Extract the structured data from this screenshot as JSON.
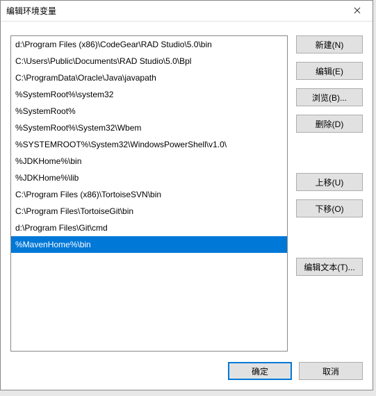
{
  "dialog": {
    "title": "编辑环境变量"
  },
  "list": {
    "items": [
      "d:\\Program Files (x86)\\CodeGear\\RAD Studio\\5.0\\bin",
      "C:\\Users\\Public\\Documents\\RAD Studio\\5.0\\Bpl",
      "C:\\ProgramData\\Oracle\\Java\\javapath",
      "%SystemRoot%\\system32",
      "%SystemRoot%",
      "%SystemRoot%\\System32\\Wbem",
      "%SYSTEMROOT%\\System32\\WindowsPowerShell\\v1.0\\",
      "%JDKHome%\\bin",
      "%JDKHome%\\lib",
      "C:\\Program Files (x86)\\TortoiseSVN\\bin",
      "C:\\Program Files\\TortoiseGit\\bin",
      "d:\\Program Files\\Git\\cmd",
      "%MavenHome%\\bin"
    ],
    "selected_index": 12
  },
  "buttons": {
    "new": "新建(N)",
    "edit": "编辑(E)",
    "browse": "浏览(B)...",
    "delete": "删除(D)",
    "move_up": "上移(U)",
    "move_down": "下移(O)",
    "edit_text": "编辑文本(T)...",
    "ok": "确定",
    "cancel": "取消"
  }
}
